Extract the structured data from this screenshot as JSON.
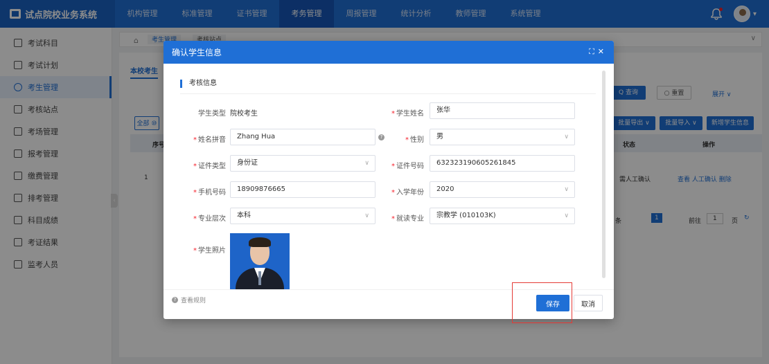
{
  "app": {
    "title": "试点院校业务系统"
  },
  "topnav": [
    {
      "label": "机构管理",
      "active": false
    },
    {
      "label": "标准管理",
      "active": false
    },
    {
      "label": "证书管理",
      "active": false
    },
    {
      "label": "考务管理",
      "active": true
    },
    {
      "label": "周报管理",
      "active": false
    },
    {
      "label": "统计分析",
      "active": false
    },
    {
      "label": "教师管理",
      "active": false
    },
    {
      "label": "系统管理",
      "active": false
    }
  ],
  "sidebar": {
    "items": [
      {
        "label": "考试科目"
      },
      {
        "label": "考试计划"
      },
      {
        "label": "考生管理",
        "active": true
      },
      {
        "label": "考核站点"
      },
      {
        "label": "考场管理"
      },
      {
        "label": "报考管理"
      },
      {
        "label": "缴费管理"
      },
      {
        "label": "排考管理"
      },
      {
        "label": "科目成绩"
      },
      {
        "label": "考证结果"
      },
      {
        "label": "监考人员"
      }
    ]
  },
  "background": {
    "breadcrumb_tab1": "考生管理",
    "breadcrumb_tab2": "考核站点",
    "subtab": "本校考生",
    "query_button": "Q 查询",
    "reset_button": "○ 重置",
    "expand_label": "展开 ∨",
    "all_badge": "全部 ⑩",
    "batch_export": "批量导出 ∨",
    "batch_import": "批量导入 ∨",
    "add_student": "新增学生信息",
    "col_index": "序号",
    "col_status": "状态",
    "col_ops": "操作",
    "row_index": "1",
    "row_status": "需人工确认",
    "row_ops": "查看  人工确认  删除",
    "pager_unit": "条",
    "pager_current": "1",
    "pager_goto": "前往",
    "pager_page_value": "1",
    "pager_page_unit": "页"
  },
  "modal": {
    "title": "确认学生信息",
    "section_title": "考核信息",
    "fields": {
      "student_type": {
        "label": "学生类型",
        "value": "院校考生"
      },
      "student_name": {
        "label": "学生姓名",
        "value": "张华"
      },
      "name_pinyin": {
        "label": "姓名拼音",
        "value": "Zhang Hua"
      },
      "gender": {
        "label": "性别",
        "value": "男"
      },
      "id_type": {
        "label": "证件类型",
        "value": "身份证"
      },
      "id_number": {
        "label": "证件号码",
        "value": "632323190605261845"
      },
      "phone": {
        "label": "手机号码",
        "value": "18909876665"
      },
      "enroll_year": {
        "label": "入学年份",
        "value": "2020"
      },
      "major_level": {
        "label": "专业层次",
        "value": "本科"
      },
      "major": {
        "label": "就读专业",
        "value": "宗教学 (010103K)"
      },
      "photo": {
        "label": "学生照片"
      }
    },
    "rules_link": "查看规则",
    "save_label": "保存",
    "cancel_label": "取消"
  },
  "colors": {
    "primary": "#1f6fd6",
    "required": "#f5222d",
    "highlight": "#e53935"
  }
}
